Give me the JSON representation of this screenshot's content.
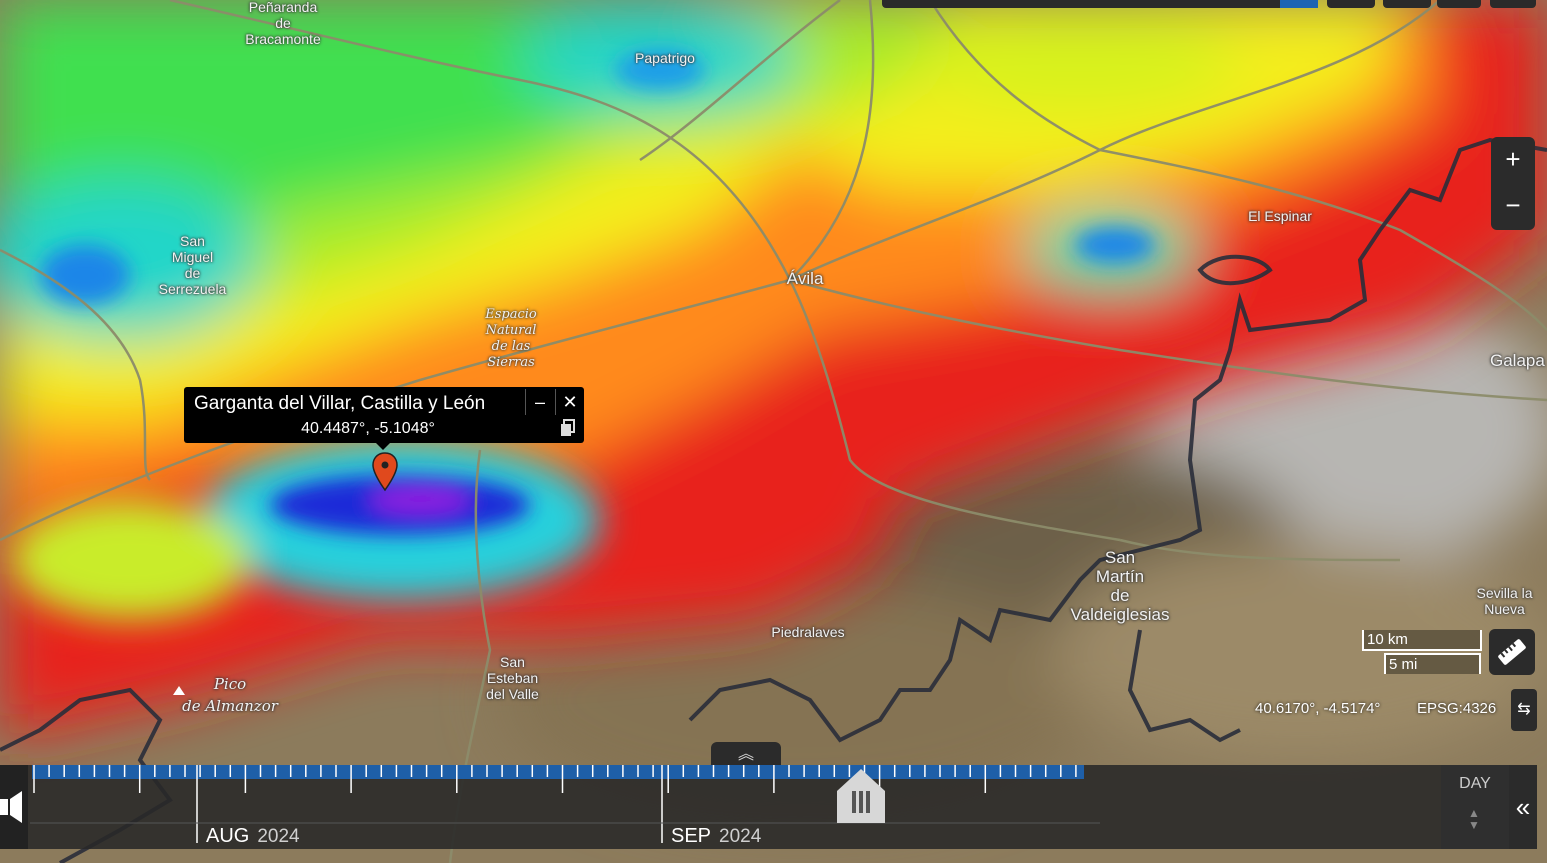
{
  "map": {
    "places": [
      {
        "name": "Peñaranda\nde\nBracamonte",
        "style": "normal"
      },
      {
        "name": "Papatrigo",
        "style": "normal"
      },
      {
        "name": "San\nMiguel\nde\nSerrezuela",
        "style": "normal"
      },
      {
        "name": "Ávila",
        "style": "big"
      },
      {
        "name": "El Espinar",
        "style": "normal"
      },
      {
        "name": "Galapa",
        "style": "normal"
      },
      {
        "name": "Espacio\nNatural\nde las\nSierras",
        "style": "italic"
      },
      {
        "name": "San\nMartín\nde\nValdeiglesias",
        "style": "big"
      },
      {
        "name": "Piedralaves",
        "style": "normal"
      },
      {
        "name": "Sevilla la\nNueva",
        "style": "normal"
      },
      {
        "name": "San\nEsteban\ndel Valle",
        "style": "normal"
      },
      {
        "name": "Pico\nde Almanzor",
        "style": "italic"
      }
    ]
  },
  "popup": {
    "title": "Garganta del Villar, Castilla y León",
    "coords": "40.4487°, -5.1048°",
    "minimize_icon": "minimize-icon",
    "close_icon": "close-icon",
    "copy_icon": "copy-icon"
  },
  "controls": {
    "zoom_in": "+",
    "zoom_out": "−",
    "scale_km": "10 km",
    "scale_mi": "5 mi",
    "cursor_coords": "40.6170°, -4.5174°",
    "projection": "EPSG:4326"
  },
  "timeline": {
    "months": [
      {
        "label": "AUG",
        "year": "2024"
      },
      {
        "label": "SEP",
        "year": "2024"
      }
    ],
    "zoom_level": "DAY",
    "expand_icon": "chevron-up-icon",
    "collapse_icon": "double-chevron-left-icon"
  }
}
